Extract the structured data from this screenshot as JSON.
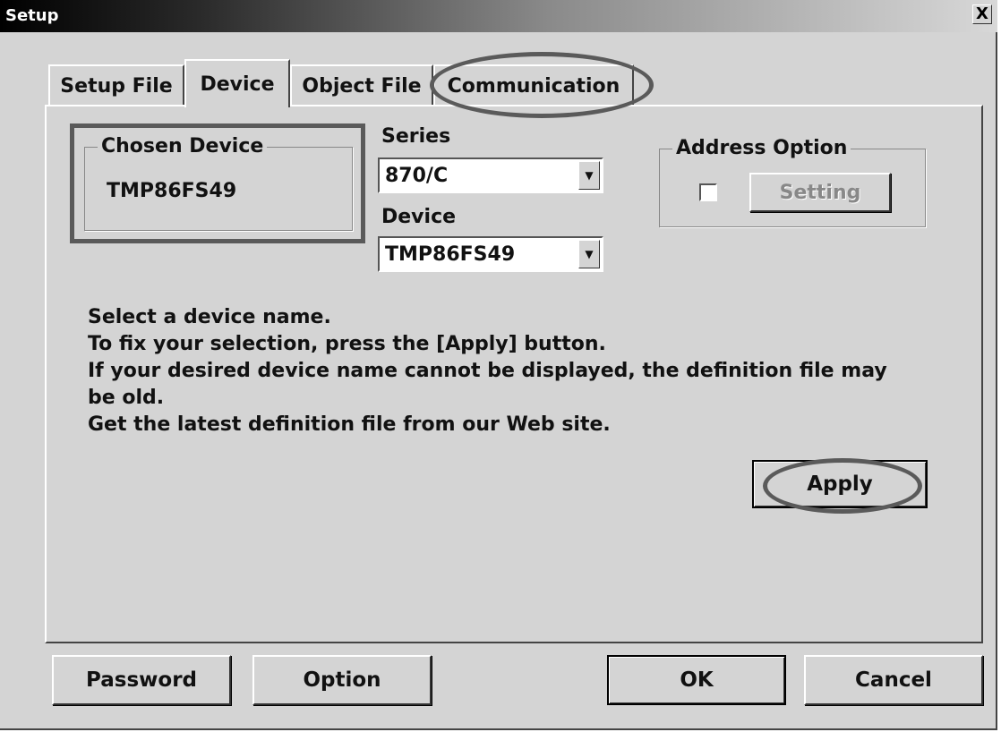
{
  "window": {
    "title": "Setup",
    "close_glyph": "X"
  },
  "tabs": [
    {
      "label": "Setup File",
      "active": false
    },
    {
      "label": "Device",
      "active": true
    },
    {
      "label": "Object File",
      "active": false
    },
    {
      "label": "Communication",
      "active": false
    }
  ],
  "chosen_device": {
    "legend": "Chosen Device",
    "value": "TMP86FS49"
  },
  "series": {
    "label": "Series",
    "value": "870/C"
  },
  "device": {
    "label": "Device",
    "value": "TMP86FS49"
  },
  "address_option": {
    "legend": "Address Option",
    "checked": false,
    "setting_label": "Setting"
  },
  "info_lines": [
    "Select a device name.",
    "To fix your selection, press the [Apply] button.",
    "If your desired device name cannot be displayed, the definition file may",
    "be old.",
    "Get the latest definition file from our Web site."
  ],
  "apply_label": "Apply",
  "footer": {
    "password_label": "Password",
    "option_label": "Option",
    "ok_label": "OK",
    "cancel_label": "Cancel"
  },
  "icons": {
    "dropdown": "chevron-down-icon",
    "close": "close-icon"
  }
}
